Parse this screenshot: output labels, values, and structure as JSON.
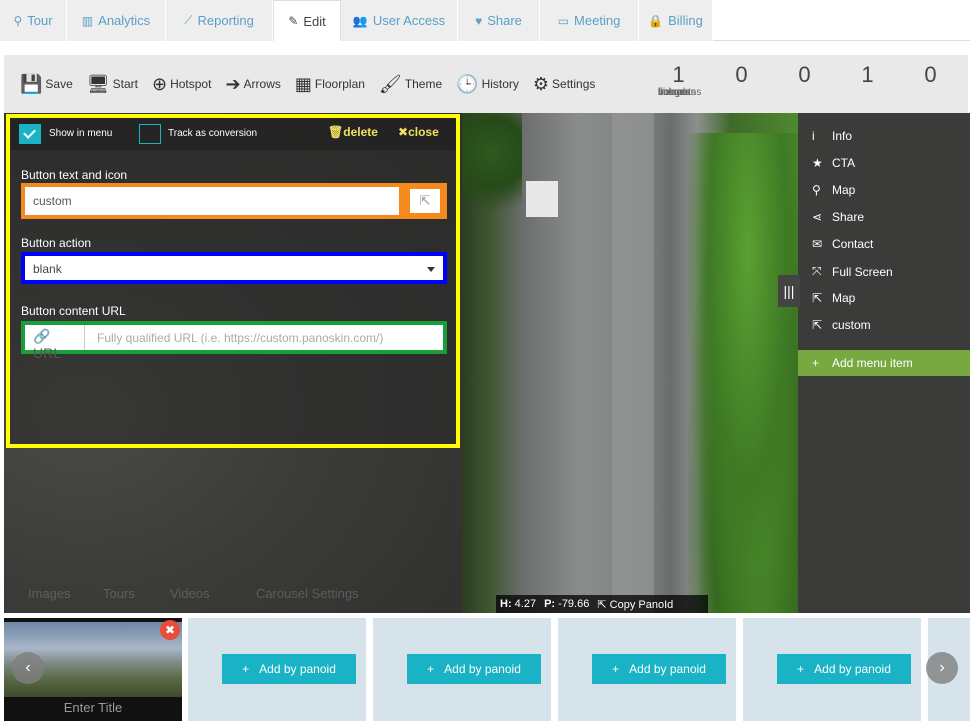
{
  "tabs": [
    {
      "label": "Tour",
      "icon": "map-marker-icon"
    },
    {
      "label": "Analytics",
      "icon": "bar-chart-icon"
    },
    {
      "label": "Reporting",
      "icon": "line-chart-icon"
    },
    {
      "label": "Edit",
      "icon": "pencil-icon"
    },
    {
      "label": "User Access",
      "icon": "users-icon"
    },
    {
      "label": "Share",
      "icon": "heart-icon"
    },
    {
      "label": "Meeting",
      "icon": "monitor-icon"
    },
    {
      "label": "Billing",
      "icon": "lock-icon"
    }
  ],
  "toolbar": {
    "save": "Save",
    "start": "Start",
    "hotspot": "Hotspot",
    "arrows": "Arrows",
    "floorplan": "Floorplan",
    "theme": "Theme",
    "history": "History",
    "settings": "Settings"
  },
  "stats": [
    {
      "num": "1",
      "label": "scenes"
    },
    {
      "num": "0",
      "label": "images"
    },
    {
      "num": "0",
      "label": "videos"
    },
    {
      "num": "1",
      "label": "hotspots"
    },
    {
      "num": "0",
      "label": "floorplans"
    }
  ],
  "panel": {
    "show_in_menu": "Show in menu",
    "track_conversion": "Track as conversion",
    "delete": "delete",
    "close": "close",
    "text_label": "Button text and icon",
    "text_value": "custom",
    "action_label": "Button action",
    "action_value": "blank",
    "url_label": "Button content URL",
    "url_addon": "URL",
    "url_placeholder": "Fully qualified URL (i.e. https://custom.panoskin.com/)"
  },
  "ghost_tabs": {
    "images": "Images",
    "tours": "Tours",
    "videos": "Videos",
    "carousel": "Carousel Settings"
  },
  "menu": {
    "items": [
      {
        "label": "Info",
        "icon": "info-icon"
      },
      {
        "label": "CTA",
        "icon": "star-icon"
      },
      {
        "label": "Map",
        "icon": "map-marker-icon"
      },
      {
        "label": "Share",
        "icon": "share-icon"
      },
      {
        "label": "Contact",
        "icon": "envelope-icon"
      },
      {
        "label": "Full Screen",
        "icon": "expand-icon"
      },
      {
        "label": "Map",
        "icon": "external-link-icon"
      },
      {
        "label": "custom",
        "icon": "external-link-icon"
      }
    ],
    "add": "Add menu item"
  },
  "heading": {
    "h_label": "H:",
    "h_value": "4.27",
    "p_label": "P:",
    "p_value": "-79.66",
    "copy": "Copy PanoId"
  },
  "carousel": {
    "scene_title": "Enter Title",
    "add_label": "Add by panoid"
  }
}
